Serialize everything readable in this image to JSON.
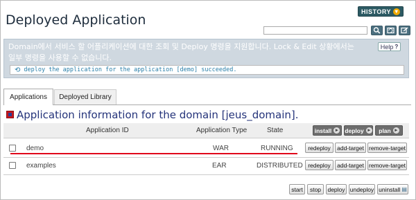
{
  "page": {
    "title": "Deployed Application",
    "history_label": "HISTORY",
    "search_placeholder": ""
  },
  "toolbar": {
    "icons": [
      "search-icon",
      "refresh-icon",
      "edit-icon"
    ]
  },
  "info": {
    "text": "Domain에서 서비스 할 어플리케이션에 대한 조회 및 Deploy 명령을 지원합니다. Lock & Edit 상황에서는 일부 명령을 사용할 수 없습니다.",
    "help_label": "Help",
    "message": "deploy the application for the application [demo] succeeded."
  },
  "tabs": [
    {
      "label": "Applications",
      "active": true
    },
    {
      "label": "Deployed Library",
      "active": false
    }
  ],
  "section": {
    "title": "Application information for the domain [jeus_domain]."
  },
  "table": {
    "headers": {
      "app_id": "Application ID",
      "app_type": "Application Type",
      "state": "State"
    },
    "header_buttons": {
      "install": "install",
      "deploy": "deploy",
      "plan": "plan"
    },
    "rows": [
      {
        "id": "demo",
        "type": "WAR",
        "state": "RUNNING",
        "buttons": {
          "redeploy": "redeploy",
          "add_target": "add-target",
          "remove_target": "remove-target"
        }
      },
      {
        "id": "examples",
        "type": "EAR",
        "state": "DISTRIBUTED",
        "buttons": {
          "redeploy": "redeploy",
          "add_target": "add-target",
          "remove_target": "remove-target"
        }
      }
    ]
  },
  "actions": {
    "start": "start",
    "stop": "stop",
    "deploy": "deploy",
    "undeploy": "undeploy",
    "uninstall": "uninstall"
  },
  "colors": {
    "accent": "#2c5a63",
    "title": "#24337a",
    "highlight": "#e0001a",
    "info_bg": "#cfd8e0"
  }
}
